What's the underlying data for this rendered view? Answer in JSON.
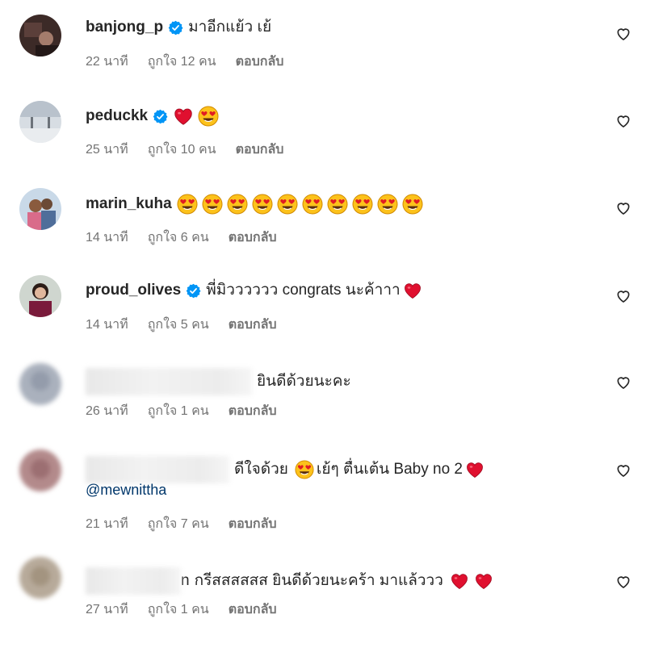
{
  "comments": [
    {
      "username": "banjong_p",
      "verified": true,
      "text": "มาอีกแย้ว เย้",
      "time": "22 นาที",
      "likes": "ถูกใจ 12 คน",
      "reply": "ตอบกลับ"
    },
    {
      "username": "peduckk",
      "verified": true,
      "text": "",
      "time": "25 นาที",
      "likes": "ถูกใจ 10 คน",
      "reply": "ตอบกลับ",
      "emojis": [
        "red-heart-icon",
        "heart-eyes-emoji-icon"
      ]
    },
    {
      "username": "marin_kuha",
      "verified": false,
      "text": "",
      "time": "14 นาที",
      "likes": "ถูกใจ 6 คน",
      "reply": "ตอบกลับ",
      "emoji_count": 10
    },
    {
      "username": "proud_olives",
      "verified": true,
      "text": "พี่มิวววววว congrats นะค้าาา",
      "time": "14 นาที",
      "likes": "ถูกใจ 5 คน",
      "reply": "ตอบกลับ"
    },
    {
      "username": "",
      "verified": false,
      "text": "ยินดีด้วยนะคะ",
      "time": "26 นาที",
      "likes": "ถูกใจ 1 คน",
      "reply": "ตอบกลับ"
    },
    {
      "username": "",
      "verified": false,
      "text_before": "ดีใจด้วย",
      "text_after": "เย้ๆ ตื่นเต้น Baby no 2",
      "mention": "@mewnittha",
      "time": "21 นาที",
      "likes": "ถูกใจ 7 คน",
      "reply": "ตอบกลับ"
    },
    {
      "username_tail": "n",
      "verified": false,
      "text": "กรีสสสสสส ยินดีด้วยนะคร้า มาแล้ววว",
      "time": "27 นาที",
      "likes": "ถูกใจ 1 คน",
      "reply": "ตอบกลับ"
    }
  ],
  "icons": {
    "like": "heart-outline-icon",
    "verified": "verified-badge-icon"
  },
  "colors": {
    "verified": "#0095f6",
    "meta": "#737373",
    "mention": "#00376b",
    "heart": "#e0102f"
  }
}
